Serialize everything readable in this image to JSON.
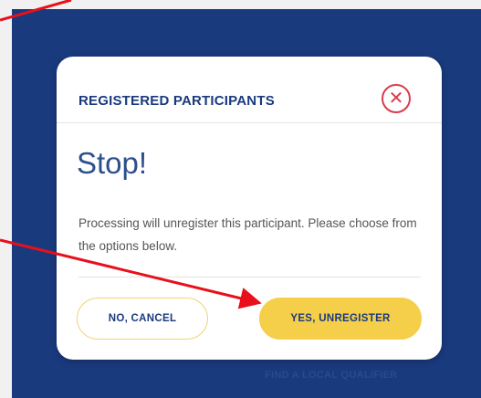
{
  "modal": {
    "title": "REGISTERED PARTICIPANTS",
    "heading": "Stop!",
    "message": "Processing will unregister this participant. Please choose from the options below.",
    "cancel_label": "NO, CANCEL",
    "confirm_label": "YES, UNREGISTER",
    "close_icon": "close-icon"
  },
  "background": {
    "partial_link": "FIND A LOCAL QUALIFIER"
  },
  "colors": {
    "backdrop": "#1a3a7e",
    "accent_yellow": "#f5cf4a",
    "close_red": "#d83c4a",
    "annotation_arrow": "#e8101a"
  }
}
